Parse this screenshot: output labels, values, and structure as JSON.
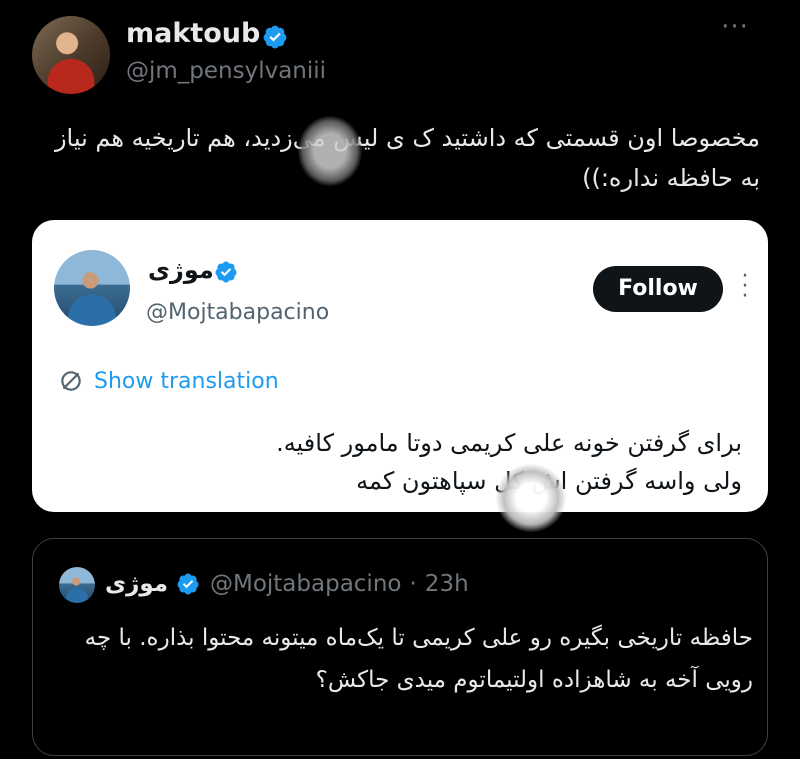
{
  "author": {
    "display_name": "maktoub",
    "handle": "@jm_pensylvaniii",
    "more_label": "···"
  },
  "tweet": {
    "text": "مخصوصا اون قسمتی که داشتید ک   ی لیس می‌زدید، هم تاریخیه هم نیاز به حافظه نداره:))"
  },
  "embed": {
    "name": "موژی",
    "handle": "@Mojtabapacino",
    "follow_label": "Follow",
    "translate_label": "Show translation",
    "text_line1": "برای گرفتن خونه علی کریمی دوتا مامور کافیه.",
    "text_line2": "ولی واسه گرفتن      اش کل سپاهتون کمه"
  },
  "quote": {
    "name": "موژی",
    "handle": "@Mojtabapacino",
    "separator": "·",
    "time": "23h",
    "text": "حافظه تاریخی بگیره رو علی کریمی تا یک‌ماه میتونه محتوا بذاره. با چه رویی آخه به شاهزاده اولتیماتوم میدی جاکش؟"
  },
  "colors": {
    "verified": "#1d9bf0",
    "link": "#1d9bf0",
    "background": "#000000",
    "card_bg": "#ffffff"
  }
}
